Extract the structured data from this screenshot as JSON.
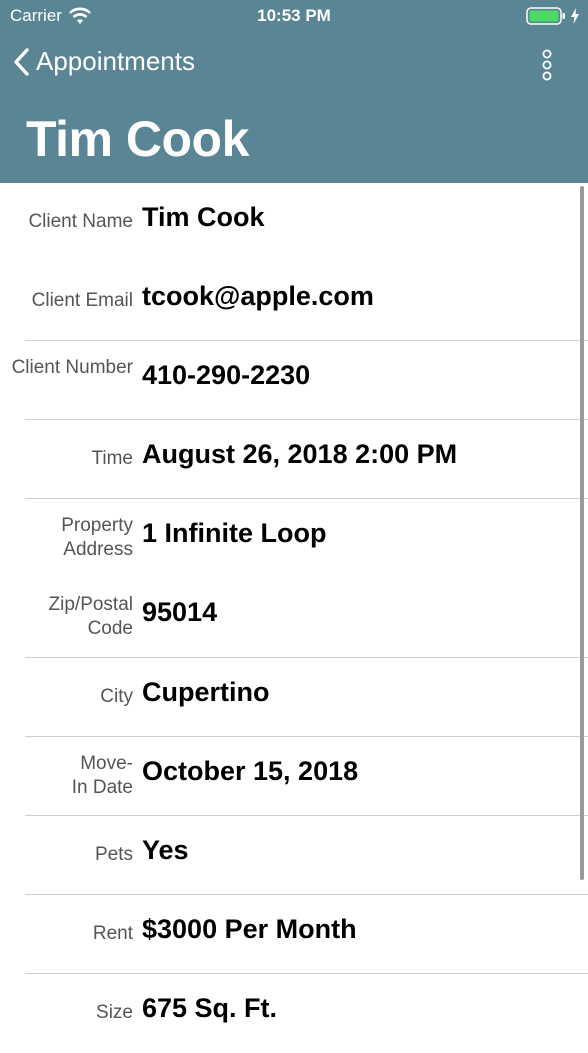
{
  "status_bar": {
    "carrier": "Carrier",
    "time": "10:53 PM",
    "battery_color": "#4cd964"
  },
  "nav": {
    "back_label": "Appointments",
    "more_icon": "vertical-ellipsis-icon"
  },
  "page_title": "Tim Cook",
  "fields": [
    {
      "label": "Client Name",
      "value": "Tim Cook"
    },
    {
      "label": "Client Email",
      "value": "tcook@apple.com"
    },
    {
      "label": "Client Number",
      "value": "410-290-2230"
    },
    {
      "label": "Time",
      "value": "August 26, 2018 2:00 PM"
    },
    {
      "label": "Property Address",
      "value": "1 Infinite Loop"
    },
    {
      "label": "Zip/Postal Code",
      "value": "95014"
    },
    {
      "label": "City",
      "value": "Cupertino"
    },
    {
      "label": "Move-In Date",
      "value": "October 15, 2018"
    },
    {
      "label": "Pets",
      "value": "Yes"
    },
    {
      "label": "Rent",
      "value": "$3000 Per Month"
    },
    {
      "label": "Size",
      "value": "675 Sq. Ft."
    }
  ],
  "colors": {
    "header_background": "#5a8594",
    "header_text": "#ffffff",
    "label_text": "#555555",
    "value_text": "#000000",
    "separator": "#cfcfcf"
  }
}
